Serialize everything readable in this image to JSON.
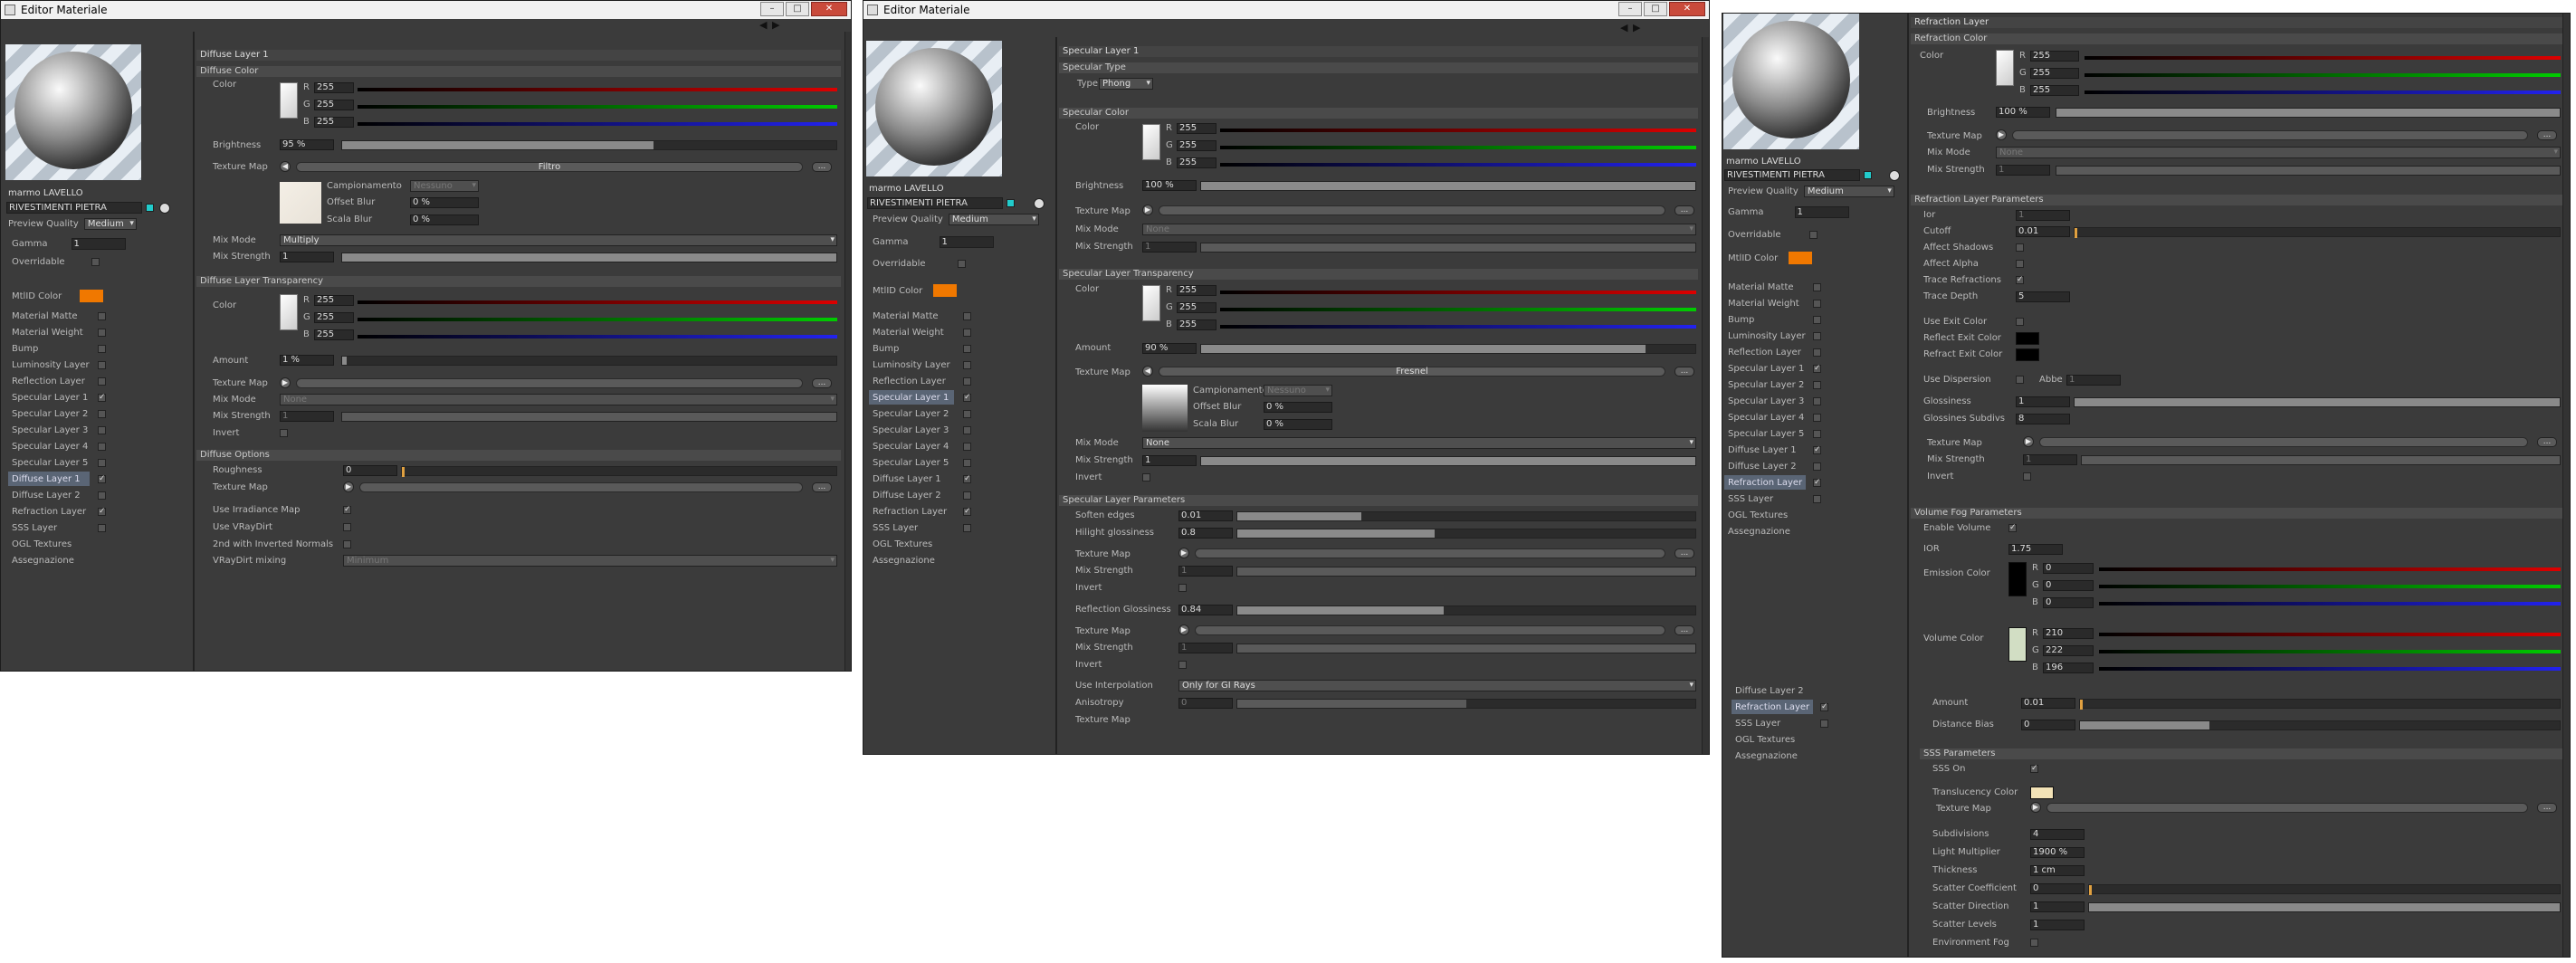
{
  "windows": [
    {
      "title": "Editor Materiale"
    },
    {
      "title": "Editor Materiale"
    }
  ],
  "material": {
    "name": "marmo LAVELLO",
    "library": "RIVESTIMENTI PIETRA",
    "preview_quality_label": "Preview Quality",
    "preview_quality": "Medium",
    "gamma_label": "Gamma",
    "gamma": "1",
    "overridable": "Overridable",
    "mtlid": "MtlID Color"
  },
  "channels1": [
    "Material Matte",
    "Material Weight",
    "Bump",
    "Luminosity Layer",
    "Reflection Layer",
    "Specular Layer 1",
    "Specular Layer 2",
    "Specular Layer 3",
    "Specular Layer 4",
    "Specular Layer 5",
    "Diffuse Layer 1",
    "Diffuse Layer 2",
    "Refraction Layer",
    "SSS Layer",
    "OGL Textures",
    "Assegnazione"
  ],
  "channels3": [
    "Material Matte",
    "Material Weight",
    "Bump",
    "Luminosity Layer",
    "Reflection Layer",
    "Specular Layer 1",
    "Specular Layer 2",
    "Specular Layer 3",
    "Specular Layer 4",
    "Specular Layer 5",
    "Diffuse Layer 1",
    "Diffuse Layer 2",
    "Refraction Layer",
    "SSS Layer",
    "OGL Textures",
    "Assegnazione"
  ],
  "p1": {
    "title": "Diffuse Layer 1",
    "sec_color": "Diffuse Color",
    "color": "Color",
    "r": "255",
    "g": "255",
    "b": "255",
    "brightness": "Brightness",
    "brightness_v": "95 %",
    "texmap": "Texture Map",
    "texmap_btn": "Filtro",
    "camp": "Campionamento",
    "camp_v": "Nessuno",
    "offblur": "Offset Blur",
    "offblur_v": "0 %",
    "scblur": "Scala Blur",
    "scblur_v": "0 %",
    "mixmode": "Mix Mode",
    "mixmode_v": "Multiply",
    "mixstr": "Mix Strength",
    "mixstr_v": "1",
    "sec_transp": "Diffuse Layer Transparency",
    "t_r": "255",
    "t_g": "255",
    "t_b": "255",
    "amount": "Amount",
    "amount_v": "1 %",
    "t_texmap": "Texture Map",
    "t_mixmode": "Mix Mode",
    "t_mixmode_v": "None",
    "t_mixstr": "Mix Strength",
    "t_mixstr_v": "1",
    "invert": "Invert",
    "sec_opts": "Diffuse Options",
    "rough": "Roughness",
    "rough_v": "0",
    "o_texmap": "Texture Map",
    "irr": "Use Irradiance Map",
    "vray": "Use VRayDirt",
    "inv_norm": "2nd with Inverted Normals",
    "vdmix": "VRayDirt mixing",
    "vdmix_v": "Minimum"
  },
  "p2": {
    "title": "Specular Layer 1",
    "sec_type": "Specular Type",
    "type": "Type",
    "type_v": "Phong",
    "sec_color": "Specular Color",
    "color": "Color",
    "r": "255",
    "g": "255",
    "b": "255",
    "brightness": "Brightness",
    "brightness_v": "100 %",
    "texmap": "Texture Map",
    "mixmode": "Mix Mode",
    "mixmode_v": "None",
    "mixstr": "Mix Strength",
    "mixstr_v": "1",
    "sec_transp": "Specular Layer Transparency",
    "t_r": "255",
    "t_g": "255",
    "t_b": "255",
    "amount": "Amount",
    "amount_v": "90 %",
    "t_texmap": "Texture Map",
    "t_texmap_btn": "Fresnel",
    "camp": "Campionamento",
    "camp_v": "Nessuno",
    "offblur": "Offset Blur",
    "offblur_v": "0 %",
    "scblur": "Scala Blur",
    "scblur_v": "0 %",
    "t_mixmode": "Mix Mode",
    "t_mixmode_v": "None",
    "t_mixstr": "Mix Strength",
    "t_mixstr_v": "1",
    "invert": "Invert",
    "sec_params": "Specular Layer Parameters",
    "soft": "Soften edges",
    "soft_v": "0.01",
    "hil": "Hilight glossiness",
    "hil_v": "0.8",
    "p_texmap": "Texture Map",
    "p_mixstr": "Mix Strength",
    "p_mixstr_v": "1",
    "p_invert": "Invert",
    "refg": "Reflection Glossiness",
    "refg_v": "0.84",
    "r_texmap": "Texture Map",
    "r_mixstr": "Mix Strength",
    "r_mixstr_v": "1",
    "r_invert": "Invert",
    "interp": "Use Interpolation",
    "interp_v": "Only for GI Rays",
    "aniso": "Anisotropy",
    "aniso_v": "0",
    "a_texmap": "Texture Map"
  },
  "p3": {
    "title": "Refraction Layer",
    "sec_color": "Refraction Color",
    "color": "Color",
    "r": "255",
    "g": "255",
    "b": "255",
    "brightness": "Brightness",
    "brightness_v": "100 %",
    "texmap": "Texture Map",
    "mixmode": "Mix Mode",
    "mixmode_v": "None",
    "mixstr": "Mix Strength",
    "mixstr_v": "1",
    "sec_params": "Refraction Layer Parameters",
    "ior": "Ior",
    "ior_v": "1",
    "cutoff": "Cutoff",
    "cutoff_v": "0.01",
    "shadows": "Affect Shadows",
    "alpha": "Affect Alpha",
    "tracer": "Trace Refractions",
    "depth": "Trace Depth",
    "depth_v": "5",
    "exit": "Use Exit Color",
    "refl_exit": "Reflect Exit Color",
    "refr_exit": "Refract Exit Color",
    "disp": "Use Dispersion",
    "abbe": "Abbe",
    "abbe_v": "1",
    "gloss": "Glossiness",
    "gloss_v": "1",
    "gsub": "Glossines Subdivs",
    "gsub_v": "8",
    "g_texmap": "Texture Map",
    "g_mixstr": "Mix Strength",
    "g_mixstr_v": "1",
    "invert": "Invert",
    "sec_fog": "Volume Fog Parameters",
    "enable": "Enable Volume",
    "fior": "IOR",
    "fior_v": "1.75",
    "emis": "Emission Color",
    "e_r": "0",
    "e_g": "0",
    "e_b": "0",
    "vol": "Volume Color",
    "v_r": "210",
    "v_g": "222",
    "v_b": "196",
    "amount": "Amount",
    "amount_v": "0.01",
    "dist": "Distance Bias",
    "dist_v": "0",
    "sec_sss": "SSS Parameters",
    "ssson": "SSS On",
    "trans": "Translucency Color",
    "s_texmap": "Texture Map",
    "subd": "Subdivisions",
    "subd_v": "4",
    "lmul": "Light Multiplier",
    "lmul_v": "1900 %",
    "thick": "Thickness",
    "thick_v": "1 cm",
    "scoef": "Scatter Coefficient",
    "scoef_v": "0",
    "sdir": "Scatter Direction",
    "sdir_v": "1",
    "slev": "Scatter Levels",
    "slev_v": "1",
    "efog": "Environment Fog"
  },
  "colors": {
    "mtlid": "#f07800",
    "trans": "#f2e2b6",
    "vol": "#d2dec4"
  }
}
